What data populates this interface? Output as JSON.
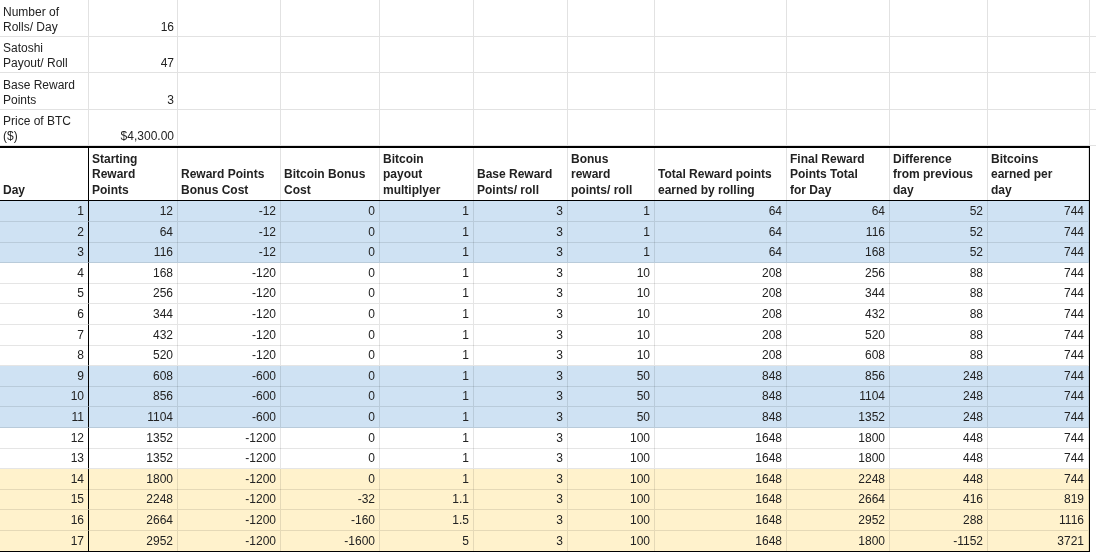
{
  "parameters": [
    {
      "label": "Number of Rolls/ Day",
      "value": "16"
    },
    {
      "label": "Satoshi Payout/ Roll",
      "value": "47"
    },
    {
      "label": "Base Reward Points",
      "value": "3"
    },
    {
      "label": "Price of BTC ($)",
      "value": "$4,300.00"
    }
  ],
  "table": {
    "columns": [
      "Day",
      "Starting Reward Points",
      "Reward Points Bonus Cost",
      "Bitcoin Bonus Cost",
      "Bitcoin payout multiplyer",
      "Base Reward Points/ roll",
      "Bonus reward points/ roll",
      "Total Reward points earned by rolling",
      "Final Reward Points Total for Day",
      "Difference from previous day",
      "Bitcoins earned per day"
    ],
    "rows": [
      {
        "color": "#cfe2f3",
        "cells": [
          "1",
          "12",
          "-12",
          "0",
          "1",
          "3",
          "1",
          "64",
          "64",
          "52",
          "744"
        ]
      },
      {
        "color": "#cfe2f3",
        "cells": [
          "2",
          "64",
          "-12",
          "0",
          "1",
          "3",
          "1",
          "64",
          "116",
          "52",
          "744"
        ]
      },
      {
        "color": "#cfe2f3",
        "cells": [
          "3",
          "116",
          "-12",
          "0",
          "1",
          "3",
          "1",
          "64",
          "168",
          "52",
          "744"
        ]
      },
      {
        "color": "#ffffff",
        "cells": [
          "4",
          "168",
          "-120",
          "0",
          "1",
          "3",
          "10",
          "208",
          "256",
          "88",
          "744"
        ]
      },
      {
        "color": "#ffffff",
        "cells": [
          "5",
          "256",
          "-120",
          "0",
          "1",
          "3",
          "10",
          "208",
          "344",
          "88",
          "744"
        ]
      },
      {
        "color": "#ffffff",
        "cells": [
          "6",
          "344",
          "-120",
          "0",
          "1",
          "3",
          "10",
          "208",
          "432",
          "88",
          "744"
        ]
      },
      {
        "color": "#ffffff",
        "cells": [
          "7",
          "432",
          "-120",
          "0",
          "1",
          "3",
          "10",
          "208",
          "520",
          "88",
          "744"
        ]
      },
      {
        "color": "#ffffff",
        "cells": [
          "8",
          "520",
          "-120",
          "0",
          "1",
          "3",
          "10",
          "208",
          "608",
          "88",
          "744"
        ]
      },
      {
        "color": "#cfe2f3",
        "cells": [
          "9",
          "608",
          "-600",
          "0",
          "1",
          "3",
          "50",
          "848",
          "856",
          "248",
          "744"
        ]
      },
      {
        "color": "#cfe2f3",
        "cells": [
          "10",
          "856",
          "-600",
          "0",
          "1",
          "3",
          "50",
          "848",
          "1104",
          "248",
          "744"
        ]
      },
      {
        "color": "#cfe2f3",
        "cells": [
          "11",
          "1104",
          "-600",
          "0",
          "1",
          "3",
          "50",
          "848",
          "1352",
          "248",
          "744"
        ]
      },
      {
        "color": "#ffffff",
        "cells": [
          "12",
          "1352",
          "-1200",
          "0",
          "1",
          "3",
          "100",
          "1648",
          "1800",
          "448",
          "744"
        ]
      },
      {
        "color": "#ffffff",
        "cells": [
          "13",
          "1352",
          "-1200",
          "0",
          "1",
          "3",
          "100",
          "1648",
          "1800",
          "448",
          "744"
        ]
      },
      {
        "color": "#fff2cc",
        "cells": [
          "14",
          "1800",
          "-1200",
          "0",
          "1",
          "3",
          "100",
          "1648",
          "2248",
          "448",
          "744"
        ]
      },
      {
        "color": "#fff2cc",
        "cells": [
          "15",
          "2248",
          "-1200",
          "-32",
          "1.1",
          "3",
          "100",
          "1648",
          "2664",
          "416",
          "819"
        ]
      },
      {
        "color": "#fff2cc",
        "cells": [
          "16",
          "2664",
          "-1200",
          "-160",
          "1.5",
          "3",
          "100",
          "1648",
          "2952",
          "288",
          "1116"
        ]
      },
      {
        "color": "#fff2cc",
        "cells": [
          "17",
          "2952",
          "-1200",
          "-1600",
          "5",
          "3",
          "100",
          "1648",
          "1800",
          "-1152",
          "3721"
        ]
      }
    ]
  }
}
